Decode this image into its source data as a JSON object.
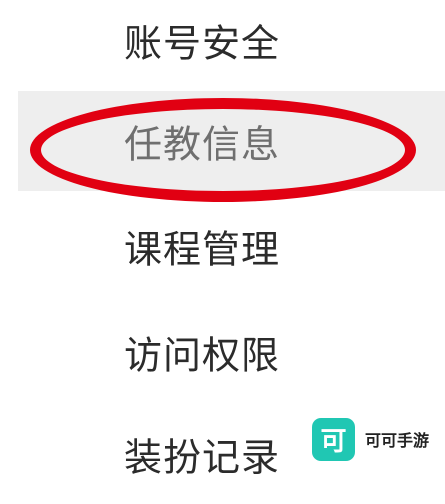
{
  "menu": {
    "items": [
      {
        "label": "账号安全",
        "selected": false
      },
      {
        "label": "任教信息",
        "selected": true
      },
      {
        "label": "课程管理",
        "selected": false
      },
      {
        "label": "访问权限",
        "selected": false
      },
      {
        "label": "装扮记录",
        "selected": false
      }
    ]
  },
  "annotation": {
    "color": "#e10012",
    "target": "任教信息"
  },
  "watermark": {
    "logo_glyph": "可",
    "text": "可可手游",
    "logo_color": "#20c7b3"
  },
  "colors": {
    "selected_background": "#eeeeee",
    "selected_text": "#6f6f6f",
    "default_text": "#2b2b2b"
  }
}
